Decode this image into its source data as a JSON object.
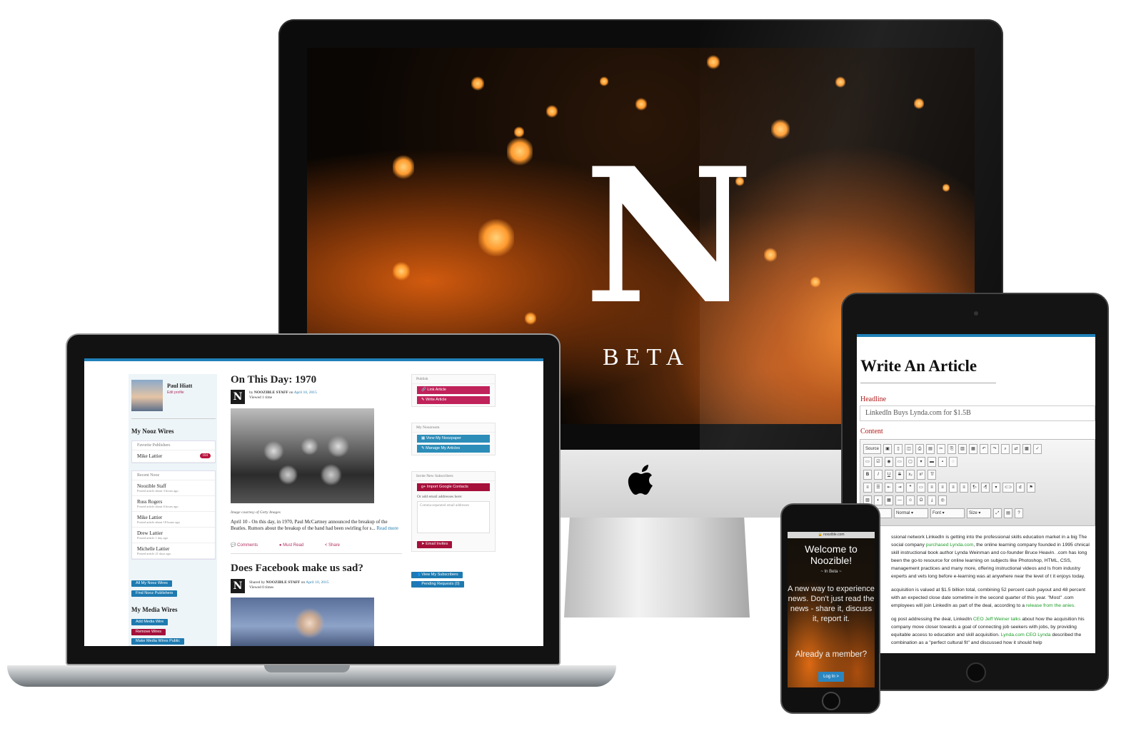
{
  "hero": {
    "logo_letter": "N",
    "beta_label": "BETA"
  },
  "laptop": {
    "user": {
      "name": "Paul Hiatt",
      "edit_link": "Edit profile"
    },
    "nooz_wires_heading": "My Nooz Wires",
    "favorite_publishers": {
      "title": "Favorite Publishers",
      "items": [
        {
          "name": "Mike Lattier",
          "count": "104"
        }
      ]
    },
    "recent_nooz": {
      "title": "Recent Nooz",
      "items": [
        {
          "name": "Noozible Staff",
          "time": "Posted article about 3 hours ago"
        },
        {
          "name": "Russ Rogers",
          "time": "Posted article about 6 hours ago"
        },
        {
          "name": "Mike Lattier",
          "time": "Posted article about 18 hours ago"
        },
        {
          "name": "Drew Lattier",
          "time": "Posted article 1 day ago"
        },
        {
          "name": "Michelle Lattier",
          "time": "Posted article 21 days ago"
        }
      ]
    },
    "wire_buttons": {
      "all": "All My Nooz Wires",
      "find": "Find Nooz Publishers"
    },
    "media_wires_heading": "My Media Wires",
    "media_buttons": {
      "add": "Add Media Wire",
      "remove": "Remove Wires",
      "public": "Make Media Wires Public"
    },
    "article1": {
      "title": "On This Day: 1970",
      "by_prefix": "by",
      "author": "NOOZIBLE STAFF",
      "on": "on",
      "date": "April 10, 2015",
      "views": "Viewed 1 time",
      "caption": "Image courtesy of Getty Images",
      "excerpt": "April 10 - On this day, in 1970, Paul McCartney announced the breakup of the Beatles.  Rumors about the breakup of the band had been swirling for s...",
      "read_more": "Read more",
      "actions": {
        "comments": "Comments",
        "must_read": "Must Read",
        "share": "Share"
      }
    },
    "article2": {
      "title": "Does Facebook make us sad?",
      "by_prefix": "Shared by",
      "author": "NOOZIBLE STAFF",
      "on": "on",
      "date": "April 10, 2015",
      "views": "Viewed 0 times"
    },
    "publish": {
      "title": "Publish",
      "link": "Link Article",
      "write": "Write Article"
    },
    "noozroom": {
      "title": "My Noozroom",
      "view": "View My Noozpaper",
      "manage": "Manage My Articles"
    },
    "invite": {
      "title": "Invite New Subscribers",
      "import": "Import Google Contacts",
      "or_add": "Or add email addresses here:",
      "placeholder": "Comma-separated email addresses",
      "send": "Email Invites"
    },
    "subscribers": {
      "view": "View My Subscribers",
      "pending": "Pending Requests (0)"
    }
  },
  "ipad": {
    "title": "Write An Article",
    "headline_label": "Headline",
    "headline_value": "LinkedIn Buys Lynda.com for $1.5B",
    "content_label": "Content",
    "toolbar": {
      "source": "Source",
      "format": "Normal",
      "font": "Font",
      "size": "Size"
    },
    "body": {
      "p1_a": "ssional network LinkedIn is getting into the professional skills education market in a big The social company ",
      "p1_link": "purchased Lynda.com",
      "p1_b": ", the online learning company founded in 1995 chnical skill instructional book author Lynda Weinman and co-founder Bruce Heavin. .com has long been the go-to resource for online learning on subjects like Photoshop, HTML, CSS, management practices and many more, offering instructional videos and ls from industry experts and vets long before e-learning was at anywhere near the level of t it enjoys today.",
      "p2_a": "acquisition is valued at $1.5 billion total, combining 52 percent cash payout and 48 percent with an expected close date sometime in the second quarter of this year. \"Most\" .com employees will join LinkedIn as part of the deal, according to a ",
      "p2_link": "release from the",
      "p2_c": "anies.",
      "p3_a": "og post addressing the deal, LinkedIn ",
      "p3_link": "CEO Jeff Weiner talks",
      "p3_b": " about how the acquisition his company move closer towards a goal of connecting job seekers with jobs, by providing equitable access to education and skill acquisition. ",
      "p3_link2": "Lynda.com CEO Lynda",
      "p3_c": " described the combination as a \"perfect cultural fit\" and discussed how it should help"
    }
  },
  "iphone": {
    "url": "noozible.com",
    "welcome": "Welcome to Noozible!",
    "in_beta": "~ In Beta ~",
    "tagline": "A new way to experience news. Don't just read the news - share it, discuss it, report it.",
    "member": "Already a member?",
    "login": "Log In >"
  },
  "colors": {
    "accent": "#1f80b8",
    "brand_red": "#a5103a",
    "link_green": "#1f9c2a"
  }
}
